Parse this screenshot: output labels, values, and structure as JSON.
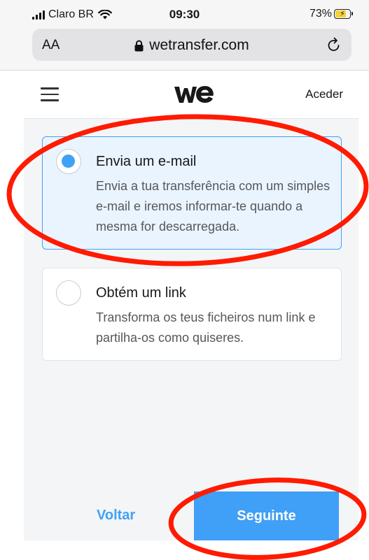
{
  "status_bar": {
    "carrier": "Claro BR",
    "time": "09:30",
    "battery": "73%",
    "battery_level": 0.73,
    "battery_color": "#f4d23a"
  },
  "browser": {
    "text_size_label": "AA",
    "url": "wetransfer.com"
  },
  "header": {
    "logo_text": "we",
    "sign_in": "Aceder"
  },
  "options": [
    {
      "title": "Envia um e-mail",
      "description": "Envia a tua transferência com um simples e-mail e iremos informar-te quando a mesma for descarregada.",
      "selected": true
    },
    {
      "title": "Obtém um link",
      "description": "Transforma os teus ficheiros num link e partilha-os como quiseres.",
      "selected": false
    }
  ],
  "footer": {
    "back_label": "Voltar",
    "next_label": "Seguinte"
  },
  "colors": {
    "accent": "#409ff6",
    "annotation": "#ff1a00",
    "panel_bg": "#f4f5f6",
    "selected_bg": "#eaf4ff"
  }
}
